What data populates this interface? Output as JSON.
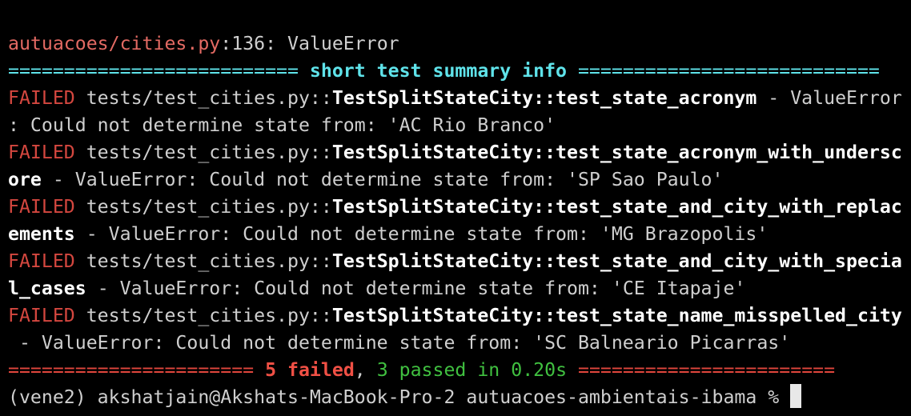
{
  "terminal": {
    "error_location": {
      "file": "autuacoes/cities.py",
      "rest": ":136: ValueError"
    },
    "summary_header": {
      "left_bar": "========================== ",
      "label": "short test summary info",
      "right_bar": " ==========================="
    },
    "failures": [
      {
        "prefix": "FAILED",
        "path": " tests/test_cities.py::",
        "test_a": "TestSplitStateCity::test_state_acronym",
        "test_b": "",
        "tail_a": " - ValueError",
        "tail_b": ": Could not determine state from: 'AC Rio Branco'"
      },
      {
        "prefix": "FAILED",
        "path": " tests/test_cities.py::",
        "test_a": "TestSplitStateCity::test_state_acronym_with_undersc",
        "test_b": "ore",
        "tail_a": "",
        "tail_b": " - ValueError: Could not determine state from: 'SP Sao Paulo'"
      },
      {
        "prefix": "FAILED",
        "path": " tests/test_cities.py::",
        "test_a": "TestSplitStateCity::test_state_and_city_with_replac",
        "test_b": "ements",
        "tail_a": "",
        "tail_b": " - ValueError: Could not determine state from: 'MG Brazopolis'"
      },
      {
        "prefix": "FAILED",
        "path": " tests/test_cities.py::",
        "test_a": "TestSplitStateCity::test_state_and_city_with_specia",
        "test_b": "l_cases",
        "tail_a": "",
        "tail_b": " - ValueError: Could not determine state from: 'CE Itapaje'"
      },
      {
        "prefix": "FAILED",
        "path": " tests/test_cities.py::",
        "test_a": "TestSplitStateCity::test_state_name_misspelled_city",
        "test_b": "",
        "tail_a": "",
        "tail_b": " - ValueError: Could not determine state from: 'SC Balneario Picarras'"
      }
    ],
    "result_line": {
      "left_bar": "====================== ",
      "failed": "5 failed",
      "comma": ", ",
      "passed": "3 passed",
      "duration": " in 0.20s",
      "right_bar": " ======================="
    },
    "prompt": "(vene2) akshatjain@Akshats-MacBook-Pro-2 autuacoes-ambientais-ibama % "
  },
  "colors": {
    "background": "#000000",
    "failed_label": "#d4473f",
    "summary_cyan": "#5fe3ea",
    "passed_green": "#40c040"
  }
}
